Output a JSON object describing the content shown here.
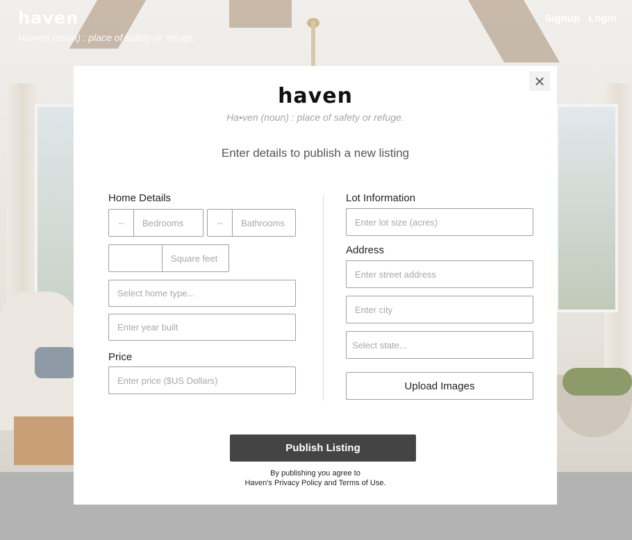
{
  "header": {
    "logo": "haven",
    "tagline": "Ha•ven (noun) : place of safety or refuge.",
    "nav": {
      "signup": "Signup",
      "login": "Login"
    }
  },
  "modal": {
    "close_icon": "×",
    "logo": "haven",
    "tagline": "Ha•ven (noun) : place of safety or refuge.",
    "subtitle": "Enter details to publish a new listing",
    "home_details": {
      "label": "Home Details",
      "bedrooms": {
        "value": "--",
        "label": "Bedrooms"
      },
      "bathrooms": {
        "value": "--",
        "label": "Bathrooms"
      },
      "square_feet": {
        "value": "",
        "label": "Square feet"
      },
      "home_type_placeholder": "Select home type...",
      "year_built_placeholder": "Enter year built"
    },
    "price": {
      "label": "Price",
      "placeholder": "Enter price ($US Dollars)"
    },
    "lot": {
      "label": "Lot Information",
      "placeholder": "Enter lot size (acres)"
    },
    "address": {
      "label": "Address",
      "street_placeholder": "Enter street address",
      "city_placeholder": "Enter city",
      "state_placeholder": "Select state..."
    },
    "upload_label": "Upload Images",
    "publish_label": "Publish Listing",
    "terms_line1": "By publishing you agree to",
    "terms_line2": "Haven's Privacy Policy and Terms of Use."
  }
}
